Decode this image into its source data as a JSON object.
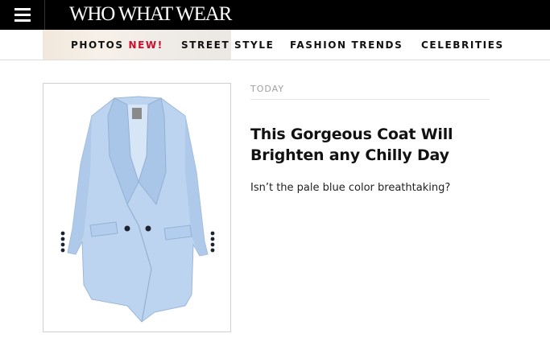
{
  "header": {
    "logo_text": "WHO WHAT WEAR",
    "menu_icon": "hamburger-menu-icon",
    "background": "#000000"
  },
  "nav": {
    "items": [
      {
        "label": "PHOTOS"
      },
      {
        "label": "STREET STYLE"
      },
      {
        "label": "FASHION TRENDS"
      },
      {
        "label": "CELEBRITIES"
      }
    ],
    "photos_badge": "NEW!",
    "badge_color": "#c8102e"
  },
  "article": {
    "category": "TODAY",
    "title": "This Gorgeous Coat Will Brighten any Chilly Day",
    "deck": "Isn’t the pale blue color breathtaking?",
    "image_icon": "light-blue-coat-image"
  }
}
